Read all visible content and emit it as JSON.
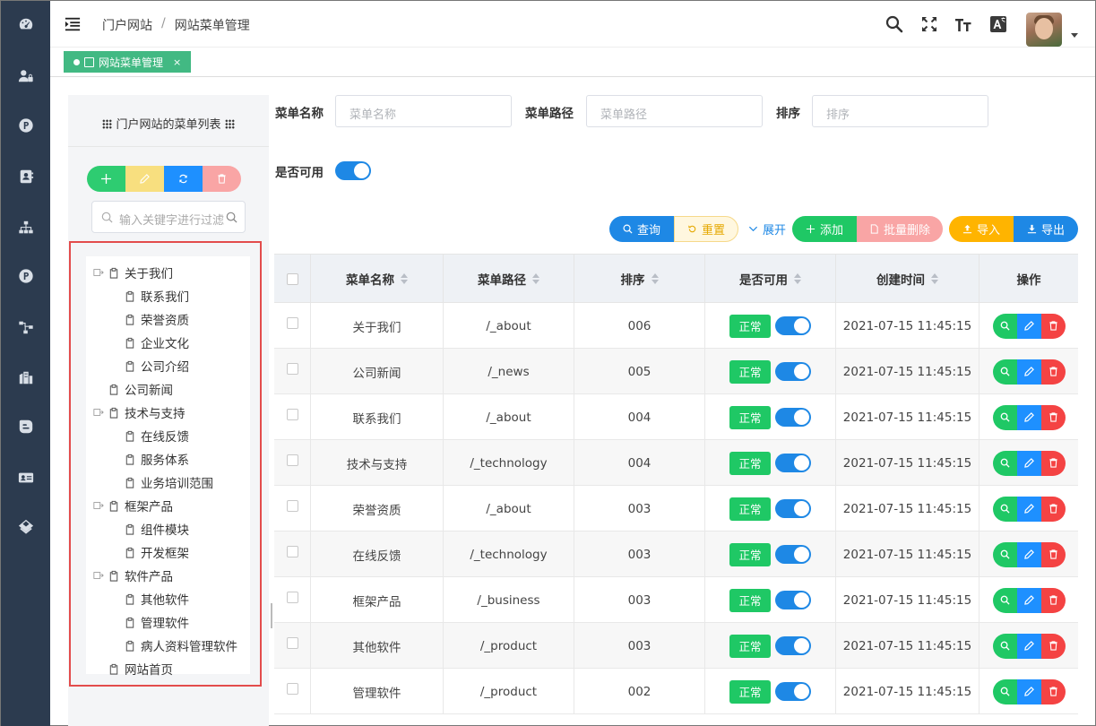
{
  "header": {
    "breadcrumb": [
      "门户网站",
      "网站菜单管理"
    ],
    "breadcrumb_sep": "/"
  },
  "tabs": [
    {
      "label": "网站菜单管理",
      "close": "×"
    }
  ],
  "tree": {
    "title": "门户网站的菜单列表",
    "search_placeholder": "输入关键字进行过滤",
    "nodes": [
      {
        "label": "关于我们",
        "level": 0,
        "expandable": true
      },
      {
        "label": "联系我们",
        "level": 1,
        "expandable": false
      },
      {
        "label": "荣誉资质",
        "level": 1,
        "expandable": false
      },
      {
        "label": "企业文化",
        "level": 1,
        "expandable": false
      },
      {
        "label": "公司介绍",
        "level": 1,
        "expandable": false
      },
      {
        "label": "公司新闻",
        "level": 0,
        "expandable": false
      },
      {
        "label": "技术与支持",
        "level": 0,
        "expandable": true
      },
      {
        "label": "在线反馈",
        "level": 1,
        "expandable": false
      },
      {
        "label": "服务体系",
        "level": 1,
        "expandable": false
      },
      {
        "label": "业务培训范围",
        "level": 1,
        "expandable": false
      },
      {
        "label": "框架产品",
        "level": 0,
        "expandable": true
      },
      {
        "label": "组件模块",
        "level": 1,
        "expandable": false
      },
      {
        "label": "开发框架",
        "level": 1,
        "expandable": false
      },
      {
        "label": "软件产品",
        "level": 0,
        "expandable": true
      },
      {
        "label": "其他软件",
        "level": 1,
        "expandable": false
      },
      {
        "label": "管理软件",
        "level": 1,
        "expandable": false
      },
      {
        "label": "病人资料管理软件",
        "level": 1,
        "expandable": false
      },
      {
        "label": "网站首页",
        "level": 0,
        "expandable": false
      }
    ]
  },
  "form": {
    "name_label": "菜单名称",
    "name_placeholder": "菜单名称",
    "path_label": "菜单路径",
    "path_placeholder": "菜单路径",
    "sort_label": "排序",
    "sort_placeholder": "排序",
    "enabled_label": "是否可用"
  },
  "toolbar": {
    "query": "查询",
    "reset": "重置",
    "expand": "展开",
    "add": "添加",
    "batch_delete": "批量删除",
    "import": "导入",
    "export": "导出"
  },
  "table": {
    "columns": [
      "菜单名称",
      "菜单路径",
      "排序",
      "是否可用",
      "创建时间",
      "操作"
    ],
    "status_label": "正常",
    "rows": [
      {
        "name": "关于我们",
        "path": "/_about",
        "sort": "006",
        "created": "2021-07-15 11:45:15"
      },
      {
        "name": "公司新闻",
        "path": "/_news",
        "sort": "005",
        "created": "2021-07-15 11:45:15"
      },
      {
        "name": "联系我们",
        "path": "/_about",
        "sort": "004",
        "created": "2021-07-15 11:45:15"
      },
      {
        "name": "技术与支持",
        "path": "/_technology",
        "sort": "004",
        "created": "2021-07-15 11:45:15"
      },
      {
        "name": "荣誉资质",
        "path": "/_about",
        "sort": "003",
        "created": "2021-07-15 11:45:15"
      },
      {
        "name": "在线反馈",
        "path": "/_technology",
        "sort": "003",
        "created": "2021-07-15 11:45:15"
      },
      {
        "name": "框架产品",
        "path": "/_business",
        "sort": "003",
        "created": "2021-07-15 11:45:15"
      },
      {
        "name": "其他软件",
        "path": "/_product",
        "sort": "003",
        "created": "2021-07-15 11:45:15"
      },
      {
        "name": "管理软件",
        "path": "/_product",
        "sort": "002",
        "created": "2021-07-15 11:45:15"
      }
    ]
  },
  "colors": {
    "rail": "#2c3b4f",
    "accent_green": "#1fc865",
    "accent_blue": "#1e90ff",
    "accent_red": "#f44343",
    "accent_orange": "#ffb400",
    "tab_green": "#42b983"
  }
}
